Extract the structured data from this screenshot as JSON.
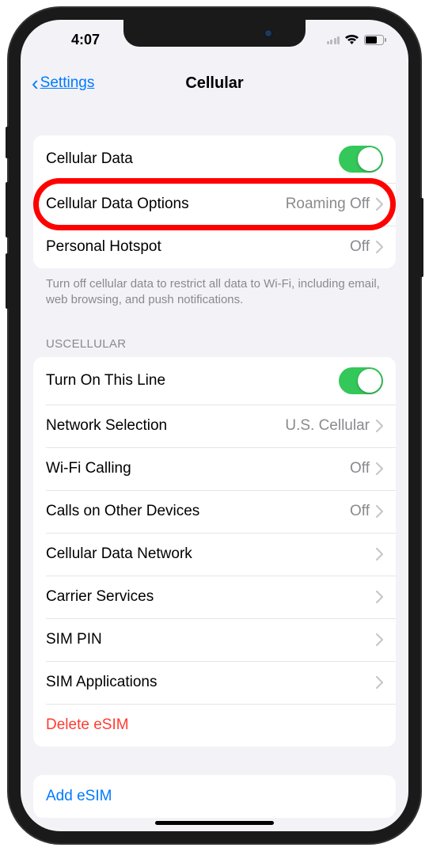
{
  "status": {
    "time": "4:07"
  },
  "nav": {
    "back": "Settings",
    "title": "Cellular"
  },
  "group1": {
    "cellular_data_label": "Cellular Data",
    "cellular_data_on": true,
    "data_options_label": "Cellular Data Options",
    "data_options_value": "Roaming Off",
    "hotspot_label": "Personal Hotspot",
    "hotspot_value": "Off",
    "footer": "Turn off cellular data to restrict all data to Wi-Fi, including email, web browsing, and push notifications."
  },
  "group2": {
    "header": "USCELLULAR",
    "turn_on_line_label": "Turn On This Line",
    "turn_on_line_on": true,
    "network_sel_label": "Network Selection",
    "network_sel_value": "U.S. Cellular",
    "wifi_calling_label": "Wi-Fi Calling",
    "wifi_calling_value": "Off",
    "calls_other_label": "Calls on Other Devices",
    "calls_other_value": "Off",
    "cdn_label": "Cellular Data Network",
    "carrier_label": "Carrier Services",
    "sim_pin_label": "SIM PIN",
    "sim_apps_label": "SIM Applications",
    "delete_esim_label": "Delete eSIM"
  },
  "group3": {
    "add_esim_label": "Add eSIM"
  }
}
